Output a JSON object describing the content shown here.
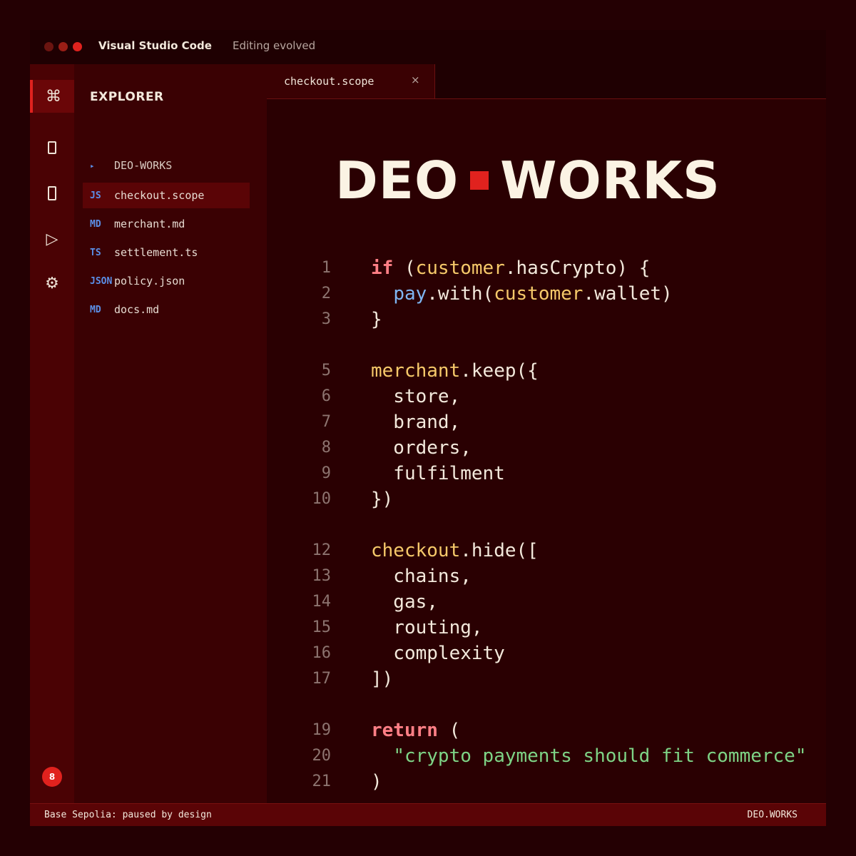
{
  "window": {
    "title": "Visual Studio Code",
    "subtitle": "Editing evolved"
  },
  "activity_bar": {
    "items": [
      {
        "name": "command",
        "glyph": "⌘"
      },
      {
        "name": "file",
        "glyph": ""
      },
      {
        "name": "search",
        "glyph": ""
      },
      {
        "name": "run",
        "glyph": "▷"
      },
      {
        "name": "settings",
        "glyph": "⚙"
      }
    ],
    "badge": "8"
  },
  "sidebar": {
    "title": "EXPLORER",
    "items": [
      {
        "type": "▸",
        "name": "DEO-WORKS"
      },
      {
        "type": "JS",
        "name": "checkout.scope"
      },
      {
        "type": "MD",
        "name": "merchant.md"
      },
      {
        "type": "TS",
        "name": "settlement.ts"
      },
      {
        "type": "JSON",
        "name": "policy.json"
      },
      {
        "type": "MD",
        "name": "docs.md"
      }
    ]
  },
  "editor": {
    "tab": {
      "label": "checkout.scope",
      "close": "×"
    },
    "brand": {
      "left": "DEO",
      "right": "WORKS"
    },
    "lines": [
      {
        "n": "1",
        "tokens": [
          [
            "kw",
            "if"
          ],
          [
            "",
            " ("
          ],
          [
            "var",
            "customer"
          ],
          [
            "",
            ".hasCrypto) {"
          ]
        ]
      },
      {
        "n": "2",
        "tokens": [
          [
            "",
            "  "
          ],
          [
            "fn",
            "pay"
          ],
          [
            "",
            ".with("
          ],
          [
            "var",
            "customer"
          ],
          [
            "",
            ".wallet)"
          ]
        ]
      },
      {
        "n": "3",
        "tokens": [
          [
            "",
            "}"
          ]
        ]
      },
      {
        "n": "5",
        "tokens": [
          [
            "var",
            "merchant"
          ],
          [
            "",
            ".keep({"
          ]
        ]
      },
      {
        "n": "6",
        "tokens": [
          [
            "",
            "  store,"
          ]
        ]
      },
      {
        "n": "7",
        "tokens": [
          [
            "",
            "  brand,"
          ]
        ]
      },
      {
        "n": "8",
        "tokens": [
          [
            "",
            "  orders,"
          ]
        ]
      },
      {
        "n": "9",
        "tokens": [
          [
            "",
            "  fulfilment"
          ]
        ]
      },
      {
        "n": "10",
        "tokens": [
          [
            "",
            "})"
          ]
        ]
      },
      {
        "n": "12",
        "tokens": [
          [
            "var",
            "checkout"
          ],
          [
            "",
            ".hide(["
          ]
        ]
      },
      {
        "n": "13",
        "tokens": [
          [
            "",
            "  chains,"
          ]
        ]
      },
      {
        "n": "14",
        "tokens": [
          [
            "",
            "  gas,"
          ]
        ]
      },
      {
        "n": "15",
        "tokens": [
          [
            "",
            "  routing,"
          ]
        ]
      },
      {
        "n": "16",
        "tokens": [
          [
            "",
            "  complexity"
          ]
        ]
      },
      {
        "n": "17",
        "tokens": [
          [
            "",
            "])"
          ]
        ]
      },
      {
        "n": "19",
        "tokens": [
          [
            "kw",
            "return"
          ],
          [
            "",
            " ("
          ]
        ]
      },
      {
        "n": "20",
        "tokens": [
          [
            "",
            "  "
          ],
          [
            "str",
            "\"crypto payments should fit commerce\""
          ]
        ]
      },
      {
        "n": "21",
        "tokens": [
          [
            "",
            ")"
          ]
        ]
      }
    ]
  },
  "status": {
    "left": "Base Sepolia: paused by design",
    "right": "DEO.WORKS"
  },
  "colors": {
    "accent": "#e0221e",
    "background": "#2a0002",
    "keyword": "#ff7f86",
    "variable": "#f6c96a",
    "function": "#7fb6f3",
    "string": "#7ed486"
  }
}
